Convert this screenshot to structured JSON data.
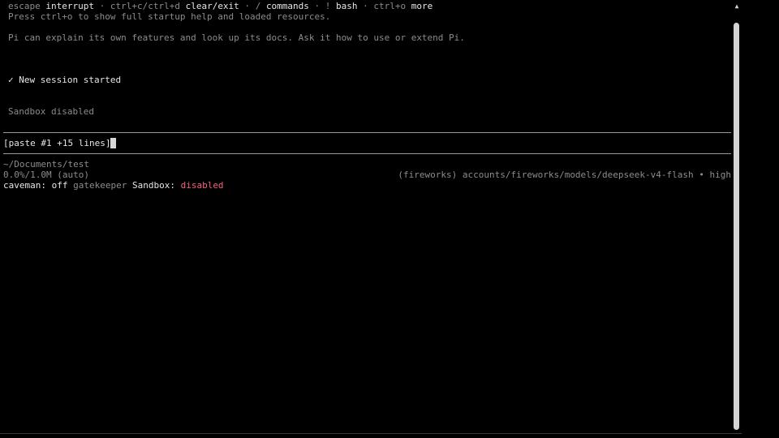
{
  "header": {
    "key_escape": "escape",
    "action_interrupt": "interrupt",
    "sep1": " · ",
    "key_clear": "ctrl+c/ctrl+d",
    "action_clear": "clear/exit",
    "sep2": " · ",
    "key_commands": "/",
    "action_commands": "commands",
    "sep3": " · ",
    "key_bash": "!",
    "action_bash": "bash",
    "sep4": " · ",
    "key_more": "ctrl+o",
    "action_more": "more",
    "startup_hint": "Press ctrl+o to show full startup help and loaded resources."
  },
  "messages": {
    "pi_intro": "Pi can explain its own features and look up its docs. Ask it how to use or extend Pi.",
    "session_check": "✓",
    "session_started": "New session started",
    "sandbox_status": "Sandbox disabled"
  },
  "input": {
    "value": "[paste #1 +15 lines]"
  },
  "footer": {
    "cwd": "~/Documents/test",
    "context_usage": "0.0%/1.0M (auto)",
    "model": "(fireworks) accounts/fireworks/models/deepseek-v4-flash • high",
    "caveman_label": "caveman:",
    "caveman_value": "off",
    "gatekeeper": "gatekeeper",
    "sandbox_label": "Sandbox:",
    "sandbox_value": "disabled"
  },
  "colors": {
    "background": "#000000",
    "text": "#c9c9c9",
    "dim_text": "#8c8c8c",
    "alert_red": "#f0637a",
    "rule": "#9a9a9a"
  },
  "icons": {
    "check": "check-icon",
    "scroll_up": "scroll-up-arrow-icon"
  }
}
